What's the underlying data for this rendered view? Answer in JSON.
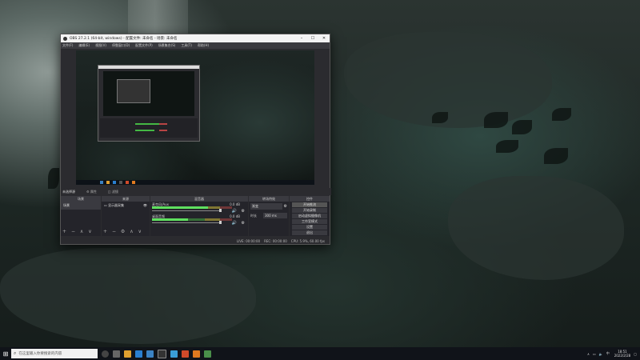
{
  "window": {
    "title": "OBS 27.2.1 (64-bit, windows) - 配置文件: 未命名 - 场景: 未命名",
    "menu": [
      "文件(F)",
      "编辑(E)",
      "视图(V)",
      "停靠窗口(D)",
      "配置文件(P)",
      "场景集合(S)",
      "工具(T)",
      "帮助(H)"
    ],
    "minimize": "–",
    "maximize": "☐",
    "close": "✕"
  },
  "source_controls": {
    "label": "未选择源",
    "properties": "属性",
    "filters": "滤镜"
  },
  "scenes": {
    "header": "场景",
    "items": [
      "场景"
    ]
  },
  "sources": {
    "header": "来源",
    "items": [
      "显示器采集"
    ]
  },
  "mixer": {
    "header": "混音器",
    "tracks": [
      {
        "name": "麦克风/Aux",
        "db": "0.0 dB",
        "level": 0.7
      },
      {
        "name": "桌面音频",
        "db": "0.0 dB",
        "level": 0.45
      }
    ]
  },
  "transitions": {
    "header": "转场特效",
    "type": "渐变",
    "duration_label": "时长",
    "duration": "300 ms"
  },
  "controls": {
    "header": "控件",
    "buttons": [
      "开始推流",
      "开始录制",
      "启动虚拟摄像机",
      "工作室模式",
      "设置",
      "退出"
    ]
  },
  "status": {
    "live": "LIVE: 00:00:00",
    "rec": "REC: 00:00:00",
    "cpu": "CPU: 5.9%, 60.00 fps"
  },
  "dock_footer": {
    "add": "+",
    "remove": "−",
    "up": "∧",
    "down": "∨",
    "gear": "⚙"
  },
  "taskbar": {
    "search_placeholder": "在这里输入你要搜索的内容",
    "start": "⊞",
    "time": "18:51",
    "date": "2022/2/28",
    "lang": "中"
  }
}
